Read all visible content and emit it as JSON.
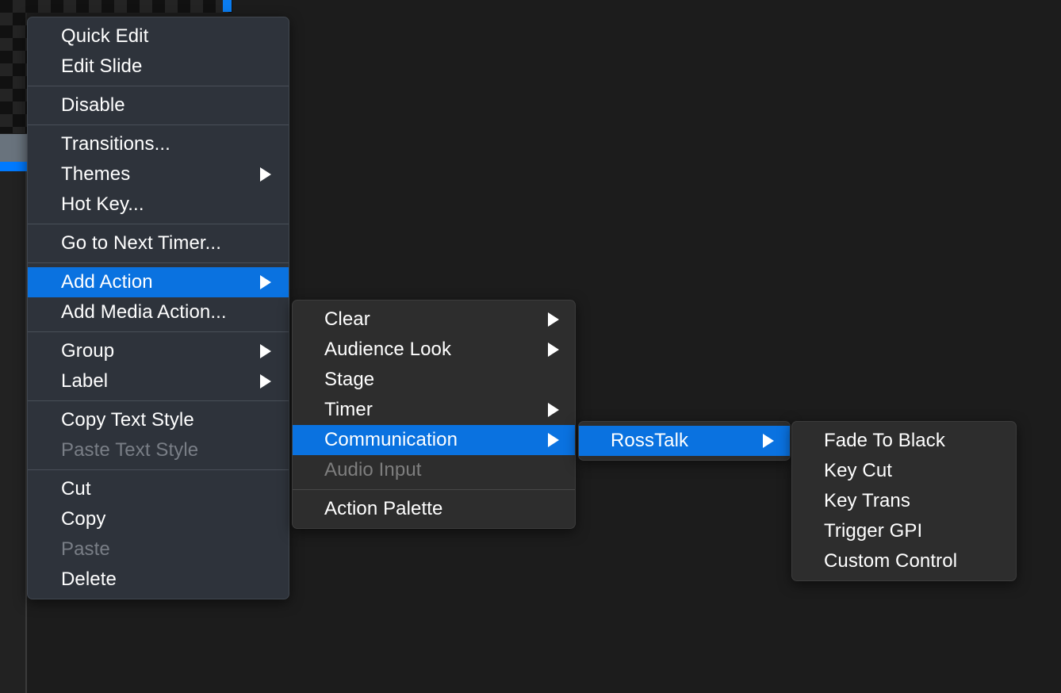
{
  "background": {
    "canvas_color": "#1c1c1c",
    "checkerboard_color_a": "#111111",
    "checkerboard_color_b": "#242424",
    "playhead_marker_color": "#0a7cf0",
    "selected_slide_color": "#69737d",
    "selected_slide_bar_color": "#007aff"
  },
  "theme": {
    "main_menu_bg": "#2e333b",
    "submenu_bg": "#2d2d2d",
    "highlight_color": "#0a72e0",
    "text_color": "#ffffff",
    "disabled_text_color": "#7e7e7e",
    "separator_color": "#494f58"
  },
  "context_menu": {
    "name": "slide-context-menu",
    "groups": [
      {
        "items": [
          {
            "label": "Quick Edit",
            "has_submenu": false,
            "disabled": false,
            "highlighted": false
          },
          {
            "label": "Edit Slide",
            "has_submenu": false,
            "disabled": false,
            "highlighted": false
          }
        ]
      },
      {
        "items": [
          {
            "label": "Disable",
            "has_submenu": false,
            "disabled": false,
            "highlighted": false
          }
        ]
      },
      {
        "items": [
          {
            "label": "Transitions...",
            "has_submenu": false,
            "disabled": false,
            "highlighted": false
          },
          {
            "label": "Themes",
            "has_submenu": true,
            "disabled": false,
            "highlighted": false
          },
          {
            "label": "Hot Key...",
            "has_submenu": false,
            "disabled": false,
            "highlighted": false
          }
        ]
      },
      {
        "items": [
          {
            "label": "Go to Next Timer...",
            "has_submenu": false,
            "disabled": false,
            "highlighted": false
          }
        ]
      },
      {
        "items": [
          {
            "label": "Add Action",
            "has_submenu": true,
            "disabled": false,
            "highlighted": true
          },
          {
            "label": "Add Media Action...",
            "has_submenu": false,
            "disabled": false,
            "highlighted": false
          }
        ]
      },
      {
        "items": [
          {
            "label": "Group",
            "has_submenu": true,
            "disabled": false,
            "highlighted": false
          },
          {
            "label": "Label",
            "has_submenu": true,
            "disabled": false,
            "highlighted": false
          }
        ]
      },
      {
        "items": [
          {
            "label": "Copy Text Style",
            "has_submenu": false,
            "disabled": false,
            "highlighted": false
          },
          {
            "label": "Paste Text Style",
            "has_submenu": false,
            "disabled": true,
            "highlighted": false
          }
        ]
      },
      {
        "items": [
          {
            "label": "Cut",
            "has_submenu": false,
            "disabled": false,
            "highlighted": false
          },
          {
            "label": "Copy",
            "has_submenu": false,
            "disabled": false,
            "highlighted": false
          },
          {
            "label": "Paste",
            "has_submenu": false,
            "disabled": true,
            "highlighted": false
          },
          {
            "label": "Delete",
            "has_submenu": false,
            "disabled": false,
            "highlighted": false
          }
        ]
      }
    ]
  },
  "add_action_submenu": {
    "name": "add-action-submenu",
    "groups": [
      {
        "items": [
          {
            "label": "Clear",
            "has_submenu": true,
            "disabled": false,
            "highlighted": false
          },
          {
            "label": "Audience Look",
            "has_submenu": true,
            "disabled": false,
            "highlighted": false
          },
          {
            "label": "Stage",
            "has_submenu": false,
            "disabled": false,
            "highlighted": false
          },
          {
            "label": "Timer",
            "has_submenu": true,
            "disabled": false,
            "highlighted": false
          },
          {
            "label": "Communication",
            "has_submenu": true,
            "disabled": false,
            "highlighted": true
          },
          {
            "label": "Audio Input",
            "has_submenu": false,
            "disabled": true,
            "highlighted": false
          }
        ]
      },
      {
        "items": [
          {
            "label": "Action Palette",
            "has_submenu": false,
            "disabled": false,
            "highlighted": false
          }
        ]
      }
    ]
  },
  "communication_submenu": {
    "name": "communication-submenu",
    "groups": [
      {
        "items": [
          {
            "label": "RossTalk",
            "has_submenu": true,
            "disabled": false,
            "highlighted": true
          }
        ]
      }
    ]
  },
  "rosstalk_submenu": {
    "name": "rosstalk-submenu",
    "groups": [
      {
        "items": [
          {
            "label": "Fade To Black",
            "has_submenu": false,
            "disabled": false,
            "highlighted": false
          },
          {
            "label": "Key Cut",
            "has_submenu": false,
            "disabled": false,
            "highlighted": false
          },
          {
            "label": "Key Trans",
            "has_submenu": false,
            "disabled": false,
            "highlighted": false
          },
          {
            "label": "Trigger GPI",
            "has_submenu": false,
            "disabled": false,
            "highlighted": false
          },
          {
            "label": "Custom Control",
            "has_submenu": false,
            "disabled": false,
            "highlighted": false
          }
        ]
      }
    ]
  }
}
